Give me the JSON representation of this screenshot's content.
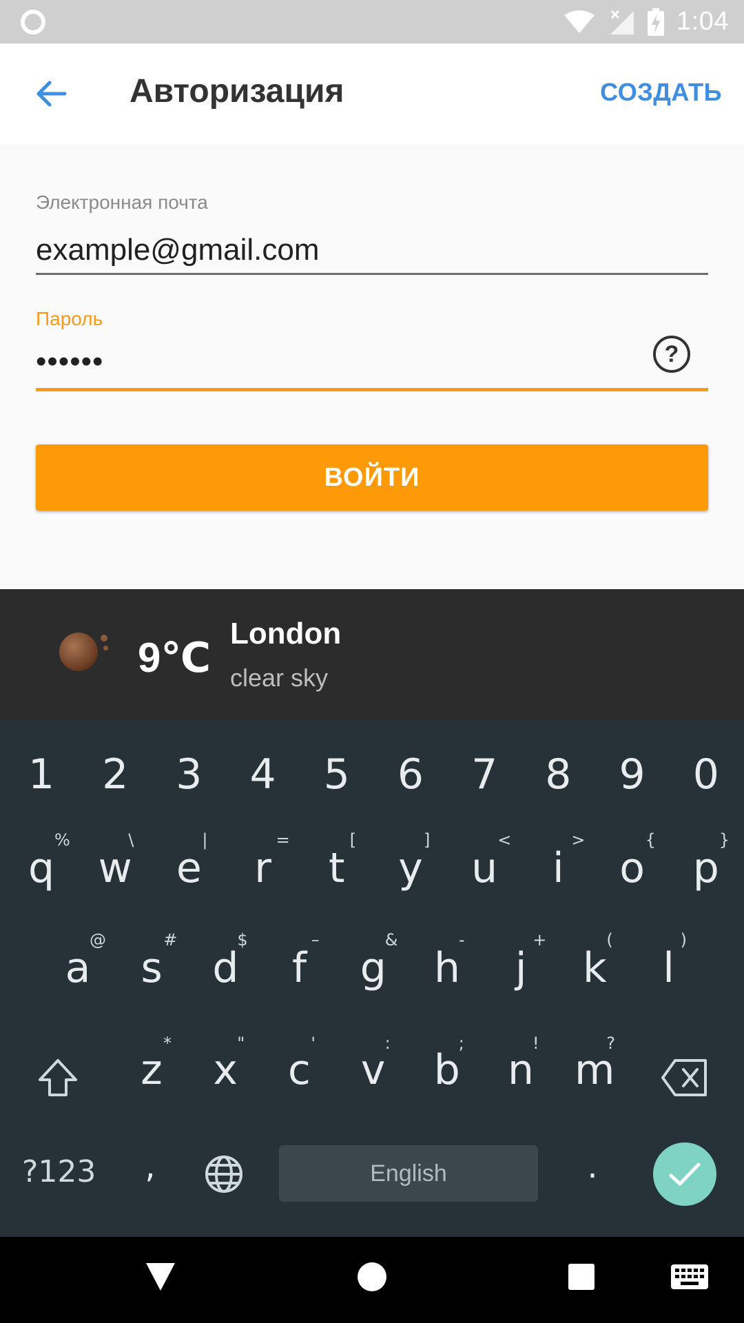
{
  "status_bar": {
    "time": "1:04"
  },
  "app_bar": {
    "title": "Авторизация",
    "action": "СОЗДАТЬ"
  },
  "form": {
    "email_label": "Электронная почта",
    "email_value": "example@gmail.com",
    "password_label": "Пароль",
    "password_value": "••••••",
    "help_symbol": "?",
    "login_button": "ВОЙТИ",
    "accent_color": "#fe9a08"
  },
  "weather": {
    "temperature": "9℃",
    "city": "London",
    "description": "clear sky"
  },
  "keyboard": {
    "number_row": [
      "1",
      "2",
      "3",
      "4",
      "5",
      "6",
      "7",
      "8",
      "9",
      "0"
    ],
    "row1": [
      {
        "key": "q",
        "hint": "%"
      },
      {
        "key": "w",
        "hint": "\\"
      },
      {
        "key": "e",
        "hint": "|"
      },
      {
        "key": "r",
        "hint": "="
      },
      {
        "key": "t",
        "hint": "["
      },
      {
        "key": "y",
        "hint": "]"
      },
      {
        "key": "u",
        "hint": "<"
      },
      {
        "key": "i",
        "hint": ">"
      },
      {
        "key": "o",
        "hint": "{"
      },
      {
        "key": "p",
        "hint": "}"
      }
    ],
    "row2": [
      {
        "key": "a",
        "hint": "@"
      },
      {
        "key": "s",
        "hint": "#"
      },
      {
        "key": "d",
        "hint": "$"
      },
      {
        "key": "f",
        "hint": "–"
      },
      {
        "key": "g",
        "hint": "&"
      },
      {
        "key": "h",
        "hint": "-"
      },
      {
        "key": "j",
        "hint": "+"
      },
      {
        "key": "k",
        "hint": "("
      },
      {
        "key": "l",
        "hint": ")"
      }
    ],
    "row3": [
      {
        "key": "z",
        "hint": "*"
      },
      {
        "key": "x",
        "hint": "\""
      },
      {
        "key": "c",
        "hint": "'"
      },
      {
        "key": "v",
        "hint": ":"
      },
      {
        "key": "b",
        "hint": ";"
      },
      {
        "key": "n",
        "hint": "!"
      },
      {
        "key": "m",
        "hint": "?"
      }
    ],
    "symbols_key": "?123",
    "comma_key": ",",
    "space_label": "English",
    "period_key": "."
  }
}
